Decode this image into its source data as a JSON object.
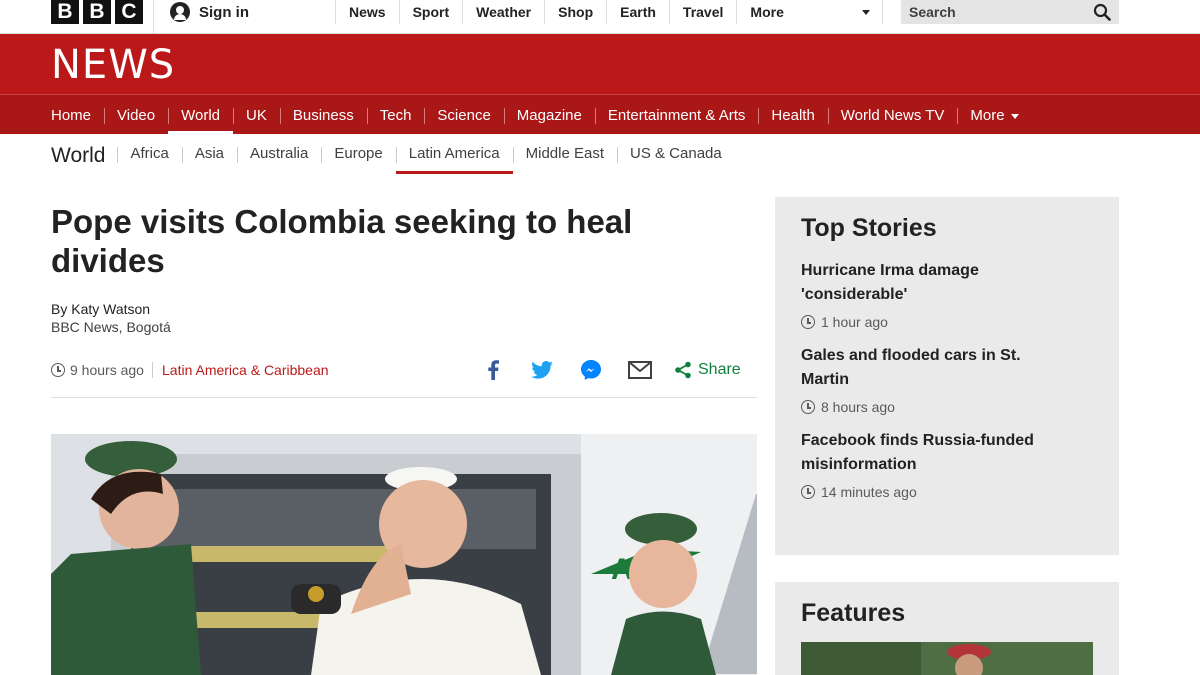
{
  "global": {
    "logo_letters": [
      "B",
      "B",
      "C"
    ],
    "signin_label": "Sign in",
    "nav": [
      "News",
      "Sport",
      "Weather",
      "Shop",
      "Earth",
      "Travel",
      "More"
    ],
    "search_placeholder": "Search"
  },
  "masthead": {
    "wordmark": "NEWS"
  },
  "section_nav": {
    "items": [
      "Home",
      "Video",
      "World",
      "UK",
      "Business",
      "Tech",
      "Science",
      "Magazine",
      "Entertainment & Arts",
      "Health",
      "World News TV",
      "More"
    ],
    "active": "World"
  },
  "world_nav": {
    "title": "World",
    "items": [
      "Africa",
      "Asia",
      "Australia",
      "Europe",
      "Latin America",
      "Middle East",
      "US & Canada"
    ],
    "current": "Latin America"
  },
  "article": {
    "headline": "Pope visits Colombia seeking to heal divides",
    "author": "By Katy Watson",
    "location": "BBC News, Bogotá",
    "timestamp": "9 hours ago",
    "category": "Latin America & Caribbean",
    "share_label": "Share",
    "share_icons": [
      "facebook-icon",
      "twitter-icon",
      "messenger-icon",
      "email-icon",
      "share-icon"
    ]
  },
  "sidebar": {
    "top_stories_title": "Top Stories",
    "stories": [
      {
        "title": "Hurricane Irma damage 'considerable'",
        "time": "1 hour ago"
      },
      {
        "title": "Gales and flooded cars in St. Martin",
        "time": "8 hours ago"
      },
      {
        "title": "Facebook finds Russia-funded misinformation",
        "time": "14 minutes ago"
      }
    ],
    "features_title": "Features"
  },
  "colors": {
    "brand_red": "#bb1919",
    "nav_red": "#a91717",
    "share_green": "#117f3d",
    "facebook_blue": "#3b5998",
    "twitter_blue": "#1da1f2"
  }
}
